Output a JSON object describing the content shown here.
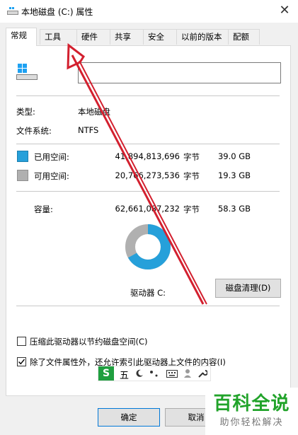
{
  "window": {
    "title": "本地磁盘 (C:) 属性",
    "close_glyph": "✕"
  },
  "tabs": [
    {
      "label": "常规",
      "active": true
    },
    {
      "label": "工具"
    },
    {
      "label": "硬件"
    },
    {
      "label": "共享"
    },
    {
      "label": "安全"
    },
    {
      "label": "以前的版本"
    },
    {
      "label": "配额"
    }
  ],
  "general": {
    "name_value": "",
    "type_label": "类型:",
    "type_value": "本地磁盘",
    "fs_label": "文件系统:",
    "fs_value": "NTFS",
    "used": {
      "label": "已用空间:",
      "bytes": "41,894,813,696",
      "unit": "字节",
      "size": "39.0 GB",
      "color": "#26a0da"
    },
    "free": {
      "label": "可用空间:",
      "bytes": "20,766,273,536",
      "unit": "字节",
      "size": "19.3 GB",
      "color": "#b0b0b0"
    },
    "capacity": {
      "label": "容量:",
      "bytes": "62,661,087,232",
      "unit": "字节",
      "size": "58.3 GB"
    },
    "used_fraction": 0.669,
    "drive_label": "驱动器 C:",
    "cleanup_label": "磁盘清理(D)",
    "compress_label": "压缩此驱动器以节约磁盘空间(C)",
    "compress_checked": false,
    "index_label": "除了文件属性外，还允许索引此驱动器上文件的内容(I)",
    "index_checked": true
  },
  "ime": {
    "logo": "S",
    "mode": "五"
  },
  "buttons": {
    "ok": "确定",
    "cancel": "取消"
  },
  "watermark": {
    "big": "百科全说",
    "small": "助你轻松解决"
  }
}
